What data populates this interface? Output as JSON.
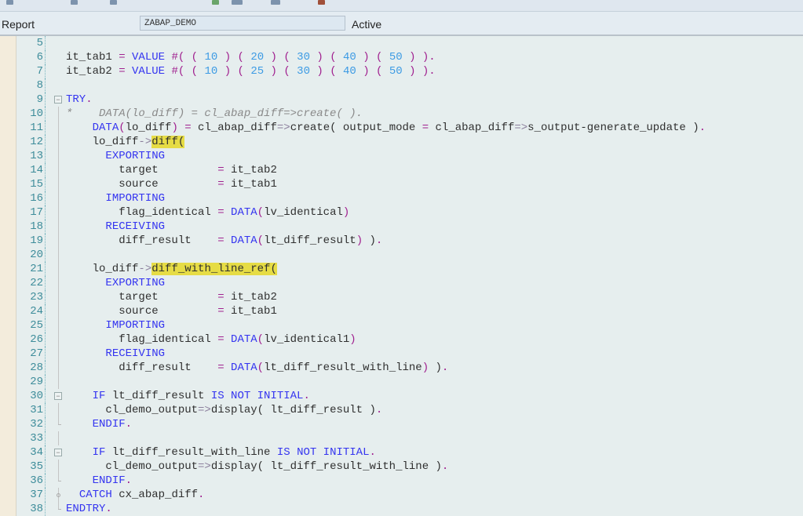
{
  "header": {
    "label": "Report",
    "program": "ZABAP_DEMO",
    "status": "Active"
  },
  "colors": {
    "keyword": "#3434f0",
    "operator": "#a0208f",
    "number": "#3d9be4",
    "comment": "#8a8a8a",
    "highlight": "#e6dc45"
  },
  "lines": [
    {
      "n": "5",
      "t": []
    },
    {
      "n": "6",
      "t": [
        [
          "t",
          "it_tab1 "
        ],
        [
          "o",
          "="
        ],
        [
          "t",
          " "
        ],
        [
          "k",
          "VALUE"
        ],
        [
          "t",
          " "
        ],
        [
          "o",
          "#("
        ],
        [
          "t",
          " "
        ],
        [
          "o",
          "("
        ],
        [
          "t",
          " "
        ],
        [
          "n",
          "10"
        ],
        [
          "t",
          " "
        ],
        [
          "o",
          ")"
        ],
        [
          "t",
          " "
        ],
        [
          "o",
          "("
        ],
        [
          "t",
          " "
        ],
        [
          "n",
          "20"
        ],
        [
          "t",
          " "
        ],
        [
          "o",
          ")"
        ],
        [
          "t",
          " "
        ],
        [
          "o",
          "("
        ],
        [
          "t",
          " "
        ],
        [
          "n",
          "30"
        ],
        [
          "t",
          " "
        ],
        [
          "o",
          ")"
        ],
        [
          "t",
          " "
        ],
        [
          "o",
          "("
        ],
        [
          "t",
          " "
        ],
        [
          "n",
          "40"
        ],
        [
          "t",
          " "
        ],
        [
          "o",
          ")"
        ],
        [
          "t",
          " "
        ],
        [
          "o",
          "("
        ],
        [
          "t",
          " "
        ],
        [
          "n",
          "50"
        ],
        [
          "t",
          " "
        ],
        [
          "o",
          ")"
        ],
        [
          "t",
          " "
        ],
        [
          "o",
          ")."
        ]
      ]
    },
    {
      "n": "7",
      "t": [
        [
          "t",
          "it_tab2 "
        ],
        [
          "o",
          "="
        ],
        [
          "t",
          " "
        ],
        [
          "k",
          "VALUE"
        ],
        [
          "t",
          " "
        ],
        [
          "o",
          "#("
        ],
        [
          "t",
          " "
        ],
        [
          "o",
          "("
        ],
        [
          "t",
          " "
        ],
        [
          "n",
          "10"
        ],
        [
          "t",
          " "
        ],
        [
          "o",
          ")"
        ],
        [
          "t",
          " "
        ],
        [
          "o",
          "("
        ],
        [
          "t",
          " "
        ],
        [
          "n",
          "25"
        ],
        [
          "t",
          " "
        ],
        [
          "o",
          ")"
        ],
        [
          "t",
          " "
        ],
        [
          "o",
          "("
        ],
        [
          "t",
          " "
        ],
        [
          "n",
          "30"
        ],
        [
          "t",
          " "
        ],
        [
          "o",
          ")"
        ],
        [
          "t",
          " "
        ],
        [
          "o",
          "("
        ],
        [
          "t",
          " "
        ],
        [
          "n",
          "40"
        ],
        [
          "t",
          " "
        ],
        [
          "o",
          ")"
        ],
        [
          "t",
          " "
        ],
        [
          "o",
          "("
        ],
        [
          "t",
          " "
        ],
        [
          "n",
          "50"
        ],
        [
          "t",
          " "
        ],
        [
          "o",
          ")"
        ],
        [
          "t",
          " "
        ],
        [
          "o",
          ")."
        ]
      ]
    },
    {
      "n": "8",
      "t": []
    },
    {
      "n": "9",
      "fold": "open",
      "t": [
        [
          "k",
          "TRY"
        ],
        [
          "o",
          "."
        ]
      ]
    },
    {
      "n": "10",
      "g": "bar",
      "t": [
        [
          "c",
          "*    DATA(lo_diff) = cl_abap_diff=>create( )."
        ]
      ]
    },
    {
      "n": "11",
      "g": "bar",
      "t": [
        [
          "t",
          "    "
        ],
        [
          "k",
          "DATA"
        ],
        [
          "o",
          "("
        ],
        [
          "t",
          "lo_diff"
        ],
        [
          "o",
          ")"
        ],
        [
          "t",
          " "
        ],
        [
          "o",
          "="
        ],
        [
          "t",
          " cl_abap_diff"
        ],
        [
          "a",
          "=>"
        ],
        [
          "t",
          "create( output_mode "
        ],
        [
          "o",
          "="
        ],
        [
          "t",
          " cl_abap_diff"
        ],
        [
          "a",
          "=>"
        ],
        [
          "t",
          "s_output-generate_update )"
        ],
        [
          "o",
          "."
        ]
      ]
    },
    {
      "n": "12",
      "g": "bar",
      "t": [
        [
          "t",
          "    lo_diff"
        ],
        [
          "a",
          "->"
        ],
        [
          "h",
          "diff"
        ],
        [
          "h",
          "("
        ]
      ]
    },
    {
      "n": "13",
      "g": "bar",
      "t": [
        [
          "t",
          "      "
        ],
        [
          "k",
          "EXPORTING"
        ]
      ]
    },
    {
      "n": "14",
      "g": "bar",
      "t": [
        [
          "t",
          "        target         "
        ],
        [
          "o",
          "="
        ],
        [
          "t",
          " it_tab2"
        ]
      ]
    },
    {
      "n": "15",
      "g": "bar",
      "t": [
        [
          "t",
          "        source         "
        ],
        [
          "o",
          "="
        ],
        [
          "t",
          " it_tab1"
        ]
      ]
    },
    {
      "n": "16",
      "g": "bar",
      "t": [
        [
          "t",
          "      "
        ],
        [
          "k",
          "IMPORTING"
        ]
      ]
    },
    {
      "n": "17",
      "g": "bar",
      "t": [
        [
          "t",
          "        flag_identical "
        ],
        [
          "o",
          "="
        ],
        [
          "t",
          " "
        ],
        [
          "k",
          "DATA"
        ],
        [
          "o",
          "("
        ],
        [
          "t",
          "lv_identical"
        ],
        [
          "o",
          ")"
        ]
      ]
    },
    {
      "n": "18",
      "g": "bar",
      "t": [
        [
          "t",
          "      "
        ],
        [
          "k",
          "RECEIVING"
        ]
      ]
    },
    {
      "n": "19",
      "g": "bar",
      "t": [
        [
          "t",
          "        diff_result    "
        ],
        [
          "o",
          "="
        ],
        [
          "t",
          " "
        ],
        [
          "k",
          "DATA"
        ],
        [
          "o",
          "("
        ],
        [
          "t",
          "lt_diff_result"
        ],
        [
          "o",
          ")"
        ],
        [
          "t",
          " )"
        ],
        [
          "o",
          "."
        ]
      ]
    },
    {
      "n": "20",
      "g": "bar",
      "t": []
    },
    {
      "n": "21",
      "g": "bar",
      "t": [
        [
          "t",
          "    lo_diff"
        ],
        [
          "a",
          "->"
        ],
        [
          "h",
          "diff_with_line_ref"
        ],
        [
          "h",
          "("
        ]
      ]
    },
    {
      "n": "22",
      "g": "bar",
      "t": [
        [
          "t",
          "      "
        ],
        [
          "k",
          "EXPORTING"
        ]
      ]
    },
    {
      "n": "23",
      "g": "bar",
      "t": [
        [
          "t",
          "        target         "
        ],
        [
          "o",
          "="
        ],
        [
          "t",
          " it_tab2"
        ]
      ]
    },
    {
      "n": "24",
      "g": "bar",
      "t": [
        [
          "t",
          "        source         "
        ],
        [
          "o",
          "="
        ],
        [
          "t",
          " it_tab1"
        ]
      ]
    },
    {
      "n": "25",
      "g": "bar",
      "t": [
        [
          "t",
          "      "
        ],
        [
          "k",
          "IMPORTING"
        ]
      ]
    },
    {
      "n": "26",
      "g": "bar",
      "t": [
        [
          "t",
          "        flag_identical "
        ],
        [
          "o",
          "="
        ],
        [
          "t",
          " "
        ],
        [
          "k",
          "DATA"
        ],
        [
          "o",
          "("
        ],
        [
          "t",
          "lv_identical1"
        ],
        [
          "o",
          ")"
        ]
      ]
    },
    {
      "n": "27",
      "g": "bar",
      "t": [
        [
          "t",
          "      "
        ],
        [
          "k",
          "RECEIVING"
        ]
      ]
    },
    {
      "n": "28",
      "g": "bar",
      "t": [
        [
          "t",
          "        diff_result    "
        ],
        [
          "o",
          "="
        ],
        [
          "t",
          " "
        ],
        [
          "k",
          "DATA"
        ],
        [
          "o",
          "("
        ],
        [
          "t",
          "lt_diff_result_with_line"
        ],
        [
          "o",
          ")"
        ],
        [
          "t",
          " )"
        ],
        [
          "o",
          "."
        ]
      ]
    },
    {
      "n": "29",
      "g": "bar",
      "t": []
    },
    {
      "n": "30",
      "fold": "open",
      "t": [
        [
          "t",
          "    "
        ],
        [
          "k",
          "IF"
        ],
        [
          "t",
          " lt_diff_result "
        ],
        [
          "k",
          "IS NOT INITIAL"
        ],
        [
          "o",
          "."
        ]
      ]
    },
    {
      "n": "31",
      "g": "bar",
      "t": [
        [
          "t",
          "      cl_demo_output"
        ],
        [
          "a",
          "=>"
        ],
        [
          "t",
          "display( lt_diff_result )"
        ],
        [
          "o",
          "."
        ]
      ]
    },
    {
      "n": "32",
      "g": "tick",
      "t": [
        [
          "t",
          "    "
        ],
        [
          "k",
          "ENDIF"
        ],
        [
          "o",
          "."
        ]
      ]
    },
    {
      "n": "33",
      "g": "bar",
      "t": []
    },
    {
      "n": "34",
      "fold": "open",
      "t": [
        [
          "t",
          "    "
        ],
        [
          "k",
          "IF"
        ],
        [
          "t",
          " lt_diff_result_with_line "
        ],
        [
          "k",
          "IS NOT INITIAL"
        ],
        [
          "o",
          "."
        ]
      ]
    },
    {
      "n": "35",
      "g": "bar",
      "t": [
        [
          "t",
          "      cl_demo_output"
        ],
        [
          "a",
          "=>"
        ],
        [
          "t",
          "display( lt_diff_result_with_line )"
        ],
        [
          "o",
          "."
        ]
      ]
    },
    {
      "n": "36",
      "g": "tick",
      "t": [
        [
          "t",
          "    "
        ],
        [
          "k",
          "ENDIF"
        ],
        [
          "o",
          "."
        ]
      ]
    },
    {
      "n": "37",
      "g": "dot",
      "t": [
        [
          "t",
          "  "
        ],
        [
          "k",
          "CATCH"
        ],
        [
          "t",
          " cx_abap_diff"
        ],
        [
          "o",
          "."
        ]
      ]
    },
    {
      "n": "38",
      "g": "tick",
      "t": [
        [
          "k",
          "ENDTRY"
        ],
        [
          "o",
          "."
        ]
      ]
    }
  ]
}
